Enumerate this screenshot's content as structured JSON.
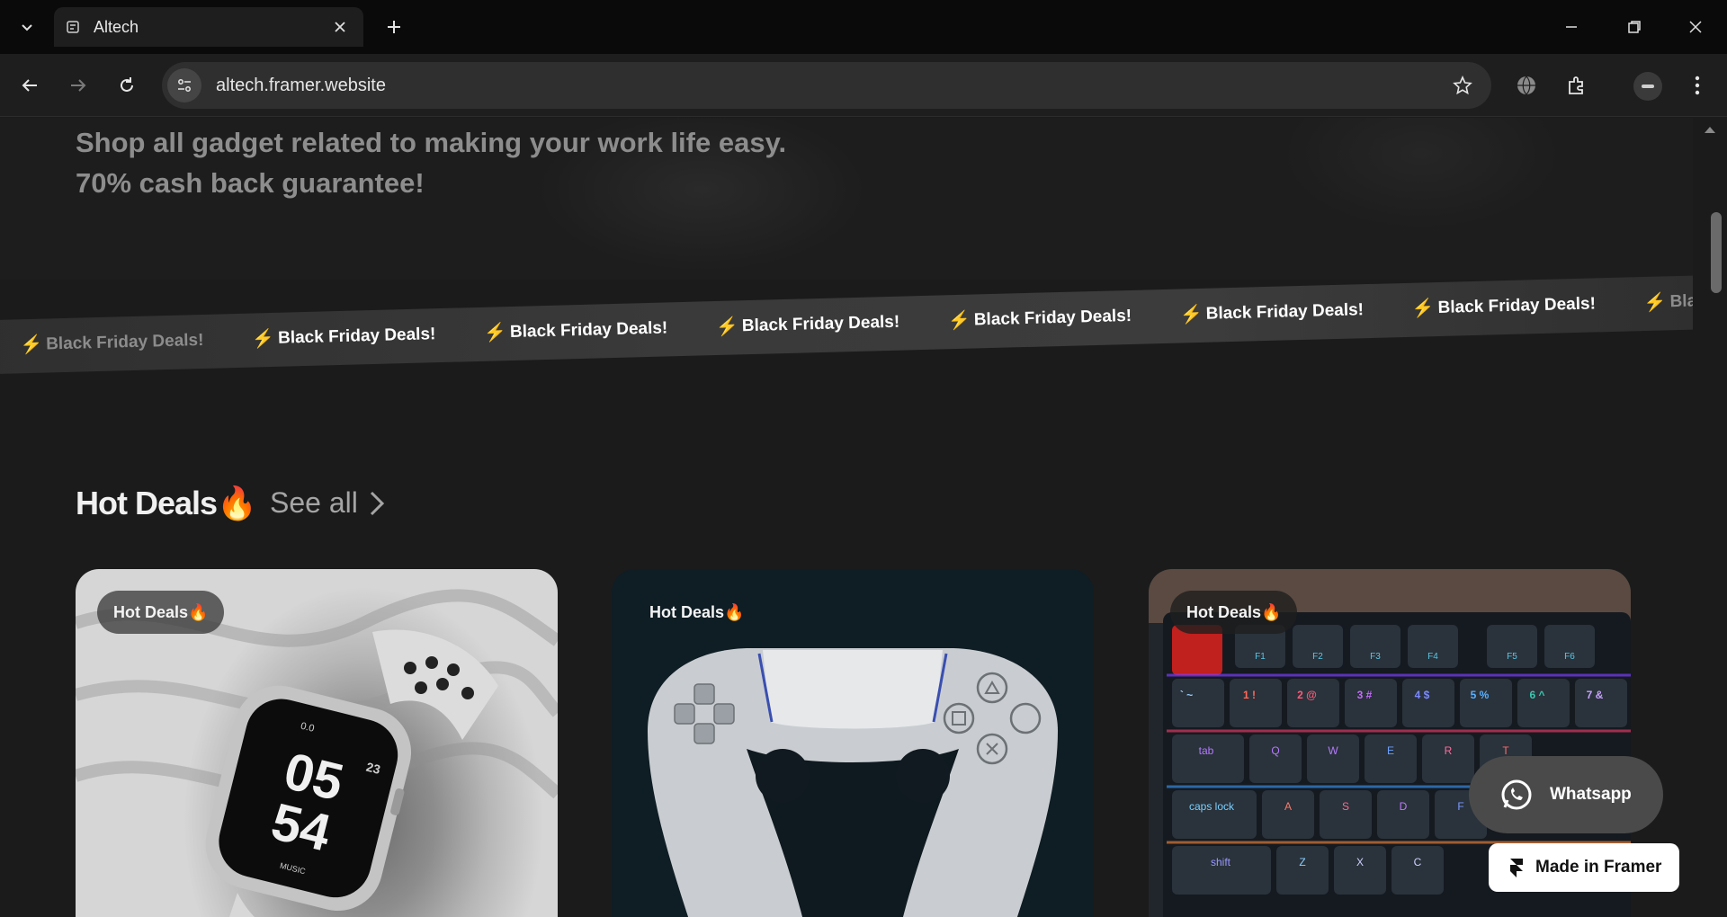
{
  "browser": {
    "tab_title": "Altech",
    "url": "altech.framer.website"
  },
  "hero": {
    "line1": "Shop all gadget related to making your work life easy.",
    "line2": "70% cash back guarantee!"
  },
  "ticker": {
    "items": [
      "Black Friday Deals!",
      "Black Friday Deals!",
      "Black Friday Deals!",
      "Black Friday Deals!",
      "Black Friday Deals!",
      "Black Friday Deals!",
      "Black Friday Deals!",
      "Black Fr"
    ]
  },
  "hot_deals": {
    "title": "Hot Deals🔥",
    "see_all": "See all",
    "cards": [
      {
        "badge": "Hot Deals🔥",
        "product": "smartwatch"
      },
      {
        "badge": "Hot Deals🔥",
        "product": "game-controller"
      },
      {
        "badge": "Hot Deals🔥",
        "product": "keyboard"
      }
    ],
    "watch_face": {
      "hours": "05",
      "minutes": "54",
      "label_top": "0.0",
      "label_side": "23",
      "label_bottom": "MUSIC"
    }
  },
  "keyboard": {
    "row_fn": [
      "F1",
      "F2",
      "F3",
      "F4",
      "F5",
      "F6"
    ],
    "row_num": [
      "` ~",
      "1 !",
      "2 @",
      "3 #",
      "4 $",
      "5 %",
      "6 ^",
      "7 &"
    ],
    "row_q": [
      "tab",
      "Q",
      "W",
      "E",
      "R",
      "T"
    ],
    "row_a": [
      "caps lock",
      "A",
      "S",
      "D",
      "F"
    ],
    "row_z": [
      "shift",
      "Z",
      "X",
      "C"
    ]
  },
  "floating": {
    "whatsapp": "Whatsapp",
    "made_in_framer": "Made in Framer"
  },
  "colors": {
    "accent_bolt": "#f7c934",
    "page_bg": "#1b1b1b"
  }
}
